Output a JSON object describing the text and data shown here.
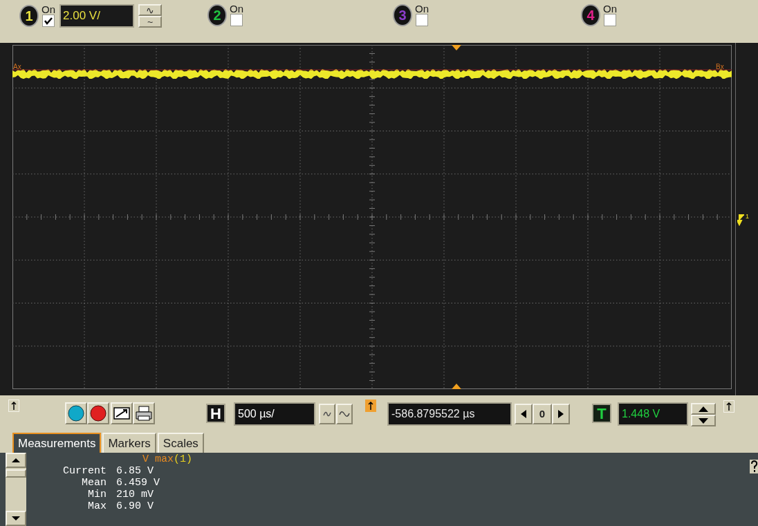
{
  "channels": [
    {
      "number": "1",
      "color": "#e8e040",
      "label": "On",
      "on": true,
      "scale": "2.00 V/",
      "coupling_buttons": [
        "∿",
        "~"
      ]
    },
    {
      "number": "2",
      "color": "#20c040",
      "label": "On",
      "on": false
    },
    {
      "number": "3",
      "color": "#8a3cc8",
      "label": "On",
      "on": false
    },
    {
      "number": "4",
      "color": "#e0208a",
      "label": "On",
      "on": false
    }
  ],
  "display": {
    "marker_a": "Ax",
    "marker_b": "Bx",
    "trigger_marker": "1"
  },
  "horizontal": {
    "label": "H",
    "scale": "500 µs/",
    "delay": "-586.8795522 µs",
    "delay_reference": "0"
  },
  "trigger": {
    "label": "T",
    "level": "1.448 V"
  },
  "tabs": [
    {
      "label": "Measurements",
      "selected": true
    },
    {
      "label": "Markers",
      "selected": false
    },
    {
      "label": "Scales",
      "selected": false
    }
  ],
  "measurement": {
    "name": "V max",
    "source": "(1)",
    "rows": [
      {
        "label": "Current",
        "value": "6.85 V"
      },
      {
        "label": "Mean",
        "value": "6.459 V"
      },
      {
        "label": "Min",
        "value": "210 mV"
      },
      {
        "label": "Max",
        "value": "6.90 V"
      }
    ]
  }
}
